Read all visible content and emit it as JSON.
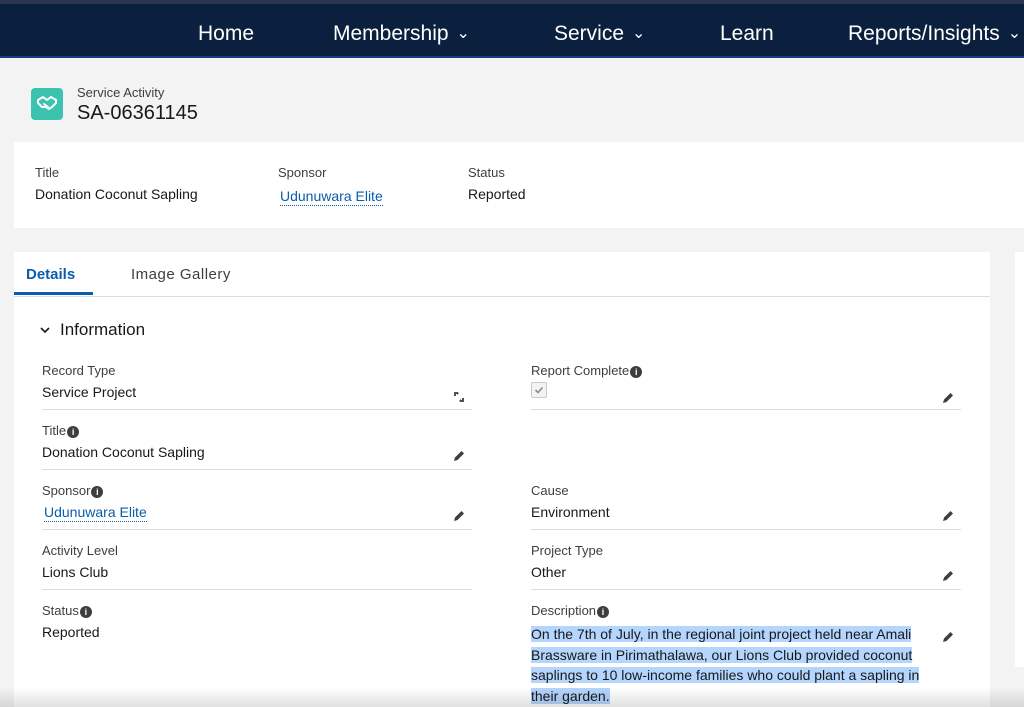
{
  "nav": {
    "items": [
      {
        "label": "Home",
        "has_menu": false
      },
      {
        "label": "Membership",
        "has_menu": true
      },
      {
        "label": "Service",
        "has_menu": true
      },
      {
        "label": "Learn",
        "has_menu": false
      },
      {
        "label": "Reports/Insights",
        "has_menu": true
      }
    ]
  },
  "record": {
    "icon": "handshake-icon",
    "object_type": "Service Activity",
    "name": "SA-06361145"
  },
  "highlights": {
    "title_label": "Title",
    "title_value": "Donation Coconut Sapling",
    "sponsor_label": "Sponsor",
    "sponsor_value": "Udunuwara Elite",
    "status_label": "Status",
    "status_value": "Reported"
  },
  "tabs": {
    "details": "Details",
    "gallery": "Image Gallery",
    "active": "Details"
  },
  "section": {
    "title": "Information",
    "expanded": true
  },
  "fields": {
    "record_type": {
      "label": "Record Type",
      "value": "Service Project"
    },
    "report_complete": {
      "label": "Report Complete",
      "checked": true
    },
    "title": {
      "label": "Title",
      "value": "Donation Coconut Sapling"
    },
    "sponsor": {
      "label": "Sponsor",
      "value": "Udunuwara Elite"
    },
    "cause": {
      "label": "Cause",
      "value": "Environment"
    },
    "activity_level": {
      "label": "Activity Level",
      "value": "Lions Club"
    },
    "project_type": {
      "label": "Project Type",
      "value": "Other"
    },
    "status": {
      "label": "Status",
      "value": "Reported"
    },
    "description": {
      "label": "Description",
      "value": "On the 7th of July, in the regional joint project held near Amali Brassware in Pirimathalawa, our Lions Club provided coconut saplings to 10 low-income families who could plant a sapling in their garden."
    }
  },
  "colors": {
    "nav_bg": "#0b1f3f",
    "link": "#0b5cab",
    "icon_bg": "#3bc3b0",
    "selection": "#b4d5fe"
  }
}
